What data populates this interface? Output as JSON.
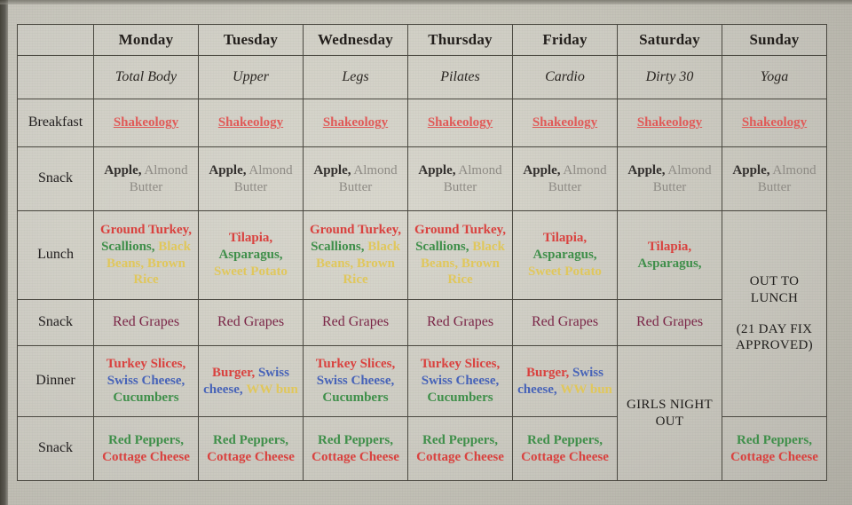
{
  "table": {
    "corner_label": "",
    "days": [
      "Monday",
      "Tuesday",
      "Wednesday",
      "Thursday",
      "Friday",
      "Saturday",
      "Sunday"
    ],
    "workouts": [
      "Total Body",
      "Upper",
      "Legs",
      "Pilates",
      "Cardio",
      "Dirty 30",
      "Yoga"
    ],
    "row_labels": [
      "Breakfast",
      "Snack",
      "Lunch",
      "Snack",
      "Dinner",
      "Snack"
    ],
    "breakfast": {
      "item": "Shakeology",
      "values": [
        "Shakeology",
        "Shakeology",
        "Shakeology",
        "Shakeology",
        "Shakeology",
        "Shakeology",
        "Shakeology"
      ]
    },
    "snack1": {
      "part_bold": "Apple,",
      "part_gray": "Almond Butter"
    },
    "lunch": {
      "monday": {
        "red": "Ground Turkey,",
        "green": "Scallions,",
        "yellow": "Black Beans, Brown Rice"
      },
      "tuesday": {
        "red": "Tilapia,",
        "green": "Asparagus,",
        "yellow": "Sweet Potato"
      },
      "wednesday": {
        "red": "Ground Turkey,",
        "green": "Scallions,",
        "yellow": "Black Beans, Brown Rice"
      },
      "thursday": {
        "red": "Ground Turkey,",
        "green": "Scallions,",
        "yellow": "Black Beans, Brown Rice"
      },
      "friday": {
        "red": "Tilapia,",
        "green": "Asparagus,",
        "yellow": "Sweet Potato"
      },
      "saturday": {
        "red": "Tilapia,",
        "green": "Asparagus,",
        "yellow": ""
      }
    },
    "snack2": {
      "value": "Red Grapes"
    },
    "dinner": {
      "monday": {
        "red": "Turkey Slices,",
        "blue": "Swiss Cheese,",
        "green": "Cucumbers",
        "yellow": ""
      },
      "tuesday": {
        "red": "Burger,",
        "blue": "Swiss cheese,",
        "green": "",
        "yellow": "WW bun"
      },
      "wednesday": {
        "red": "Turkey Slices,",
        "blue": "Swiss Cheese,",
        "green": "Cucumbers",
        "yellow": ""
      },
      "thursday": {
        "red": "Turkey Slices,",
        "blue": "Swiss Cheese,",
        "green": "Cucumbers",
        "yellow": ""
      },
      "friday": {
        "red": "Burger,",
        "blue": "Swiss cheese,",
        "green": "",
        "yellow": "WW bun"
      }
    },
    "snack3": {
      "green": "Red Peppers,",
      "red": "Cottage Cheese"
    },
    "notes": {
      "sunday_lunch_main": "OUT TO LUNCH",
      "sunday_lunch_sub": "(21 DAY FIX APPROVED)",
      "saturday_dinner": "GIRLS NIGHT OUT"
    }
  },
  "colors": {
    "red": "#d9423f",
    "green": "#3f8f4a",
    "yellow": "#e0c75c",
    "blue": "#4763b8",
    "grape": "#7a2547",
    "shakeology": "#e05a58",
    "black": "#1e1c1a",
    "paper": "#cfcdc2",
    "grid": "#4a4840"
  }
}
